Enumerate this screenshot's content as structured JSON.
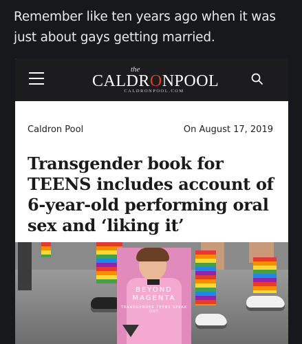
{
  "tweet": {
    "caption": "Remember like ten years ago when it was just about gays getting married."
  },
  "header": {
    "logo_the": "the",
    "logo_main_a": "CALDR",
    "logo_main_o": "O",
    "logo_main_b": "NPOOL",
    "logo_sub": "CALDRONPOOL.COM",
    "menu_icon": "hamburger-menu-icon",
    "search_icon": "search-icon"
  },
  "article": {
    "source": "Caldron Pool",
    "date": "On August 17, 2019",
    "headline": "Transgender book for TEENS includes account of 6-year-old performing oral sex and ‘liking it’"
  },
  "photo": {
    "book_title_line1": "BEYOND",
    "book_title_line2": "MAGENTA",
    "book_subtitle": "TRANSGENDER TEENS SPEAK OUT"
  },
  "colors": {
    "logo_accent": "#e23a2f",
    "book_pink": "#e18bbd"
  }
}
